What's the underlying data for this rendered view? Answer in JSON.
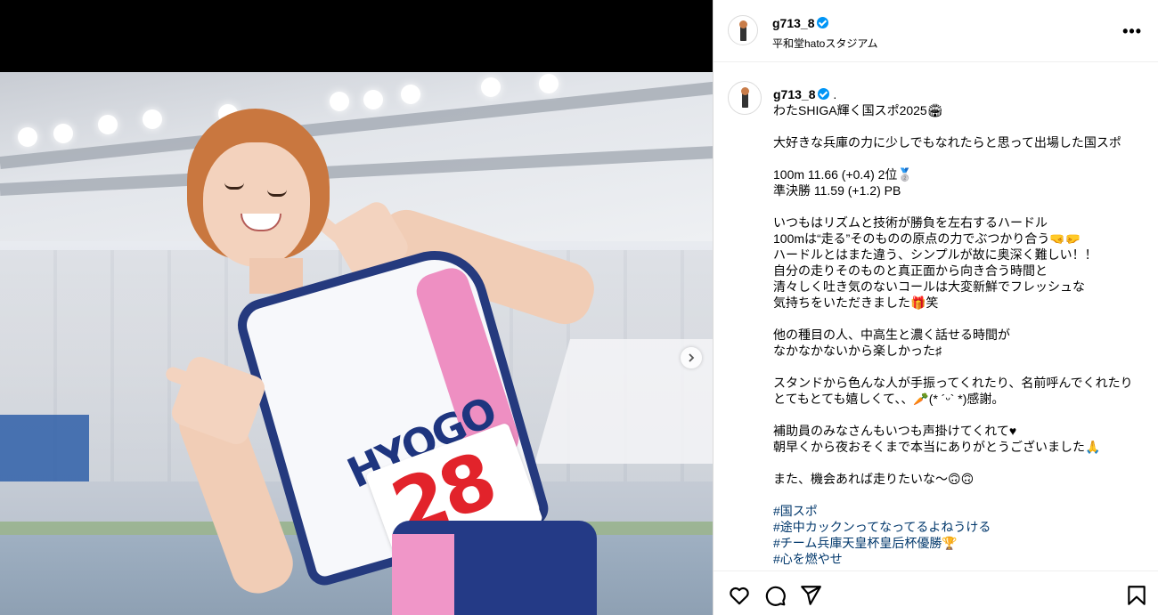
{
  "post": {
    "username": "g713_8",
    "location": "平和堂hatoスタジアム",
    "more_label": "•••"
  },
  "photo": {
    "jersey_text": "HYOGO",
    "bib_number": "28"
  },
  "caption": {
    "username": "g713_8",
    "suffix": ".",
    "lines": [
      "わたSHIGA輝く国スポ2025🏟",
      "",
      "大好きな兵庫の力に少しでもなれたらと思って出場した国スポ",
      "",
      "100m 11.66 (+0.4) 2位🥈",
      "準決勝 11.59 (+1.2) PB",
      "",
      "いつもはリズムと技術が勝負を左右するハードル",
      "100mは“走る”そのものの原点の力でぶつかり合う🤜🤛",
      "ハードルとはまた違う、シンプルが故に奥深く難しい！！",
      "自分の走りそのものと真正面から向き合う時間と",
      "清々しく吐き気のないコールは大変新鮮でフレッシュな",
      "気持ちをいただきました🎁笑",
      "",
      "他の種目の人、中高生と濃く話せる時間が",
      "なかなかないから楽しかった♯",
      "",
      "スタンドから色んな人が手振ってくれたり、名前呼んでくれたり",
      "とてもとても嬉しくて、、🥕(* ´ᵕ` *)感謝。",
      "",
      "補助員のみなさんもいつも声掛けてくれて♥",
      "朝早くから夜おそくまで本当にありがとうございました🙏",
      "",
      "また、機会あれば走りたいな〜🙃🙃",
      ""
    ],
    "hashtags": [
      "#国スポ",
      "#途中カックンってなってるよねうける",
      "#チーム兵庫天皇杯皇后杯優勝🏆",
      "#心を燃やせ"
    ]
  },
  "icons": {
    "like": "heart-icon",
    "comment": "comment-icon",
    "share": "send-icon",
    "save": "bookmark-icon",
    "next": "chevron-right-icon"
  },
  "colors": {
    "verified": "#0095f6",
    "hashtag": "#00376b"
  }
}
